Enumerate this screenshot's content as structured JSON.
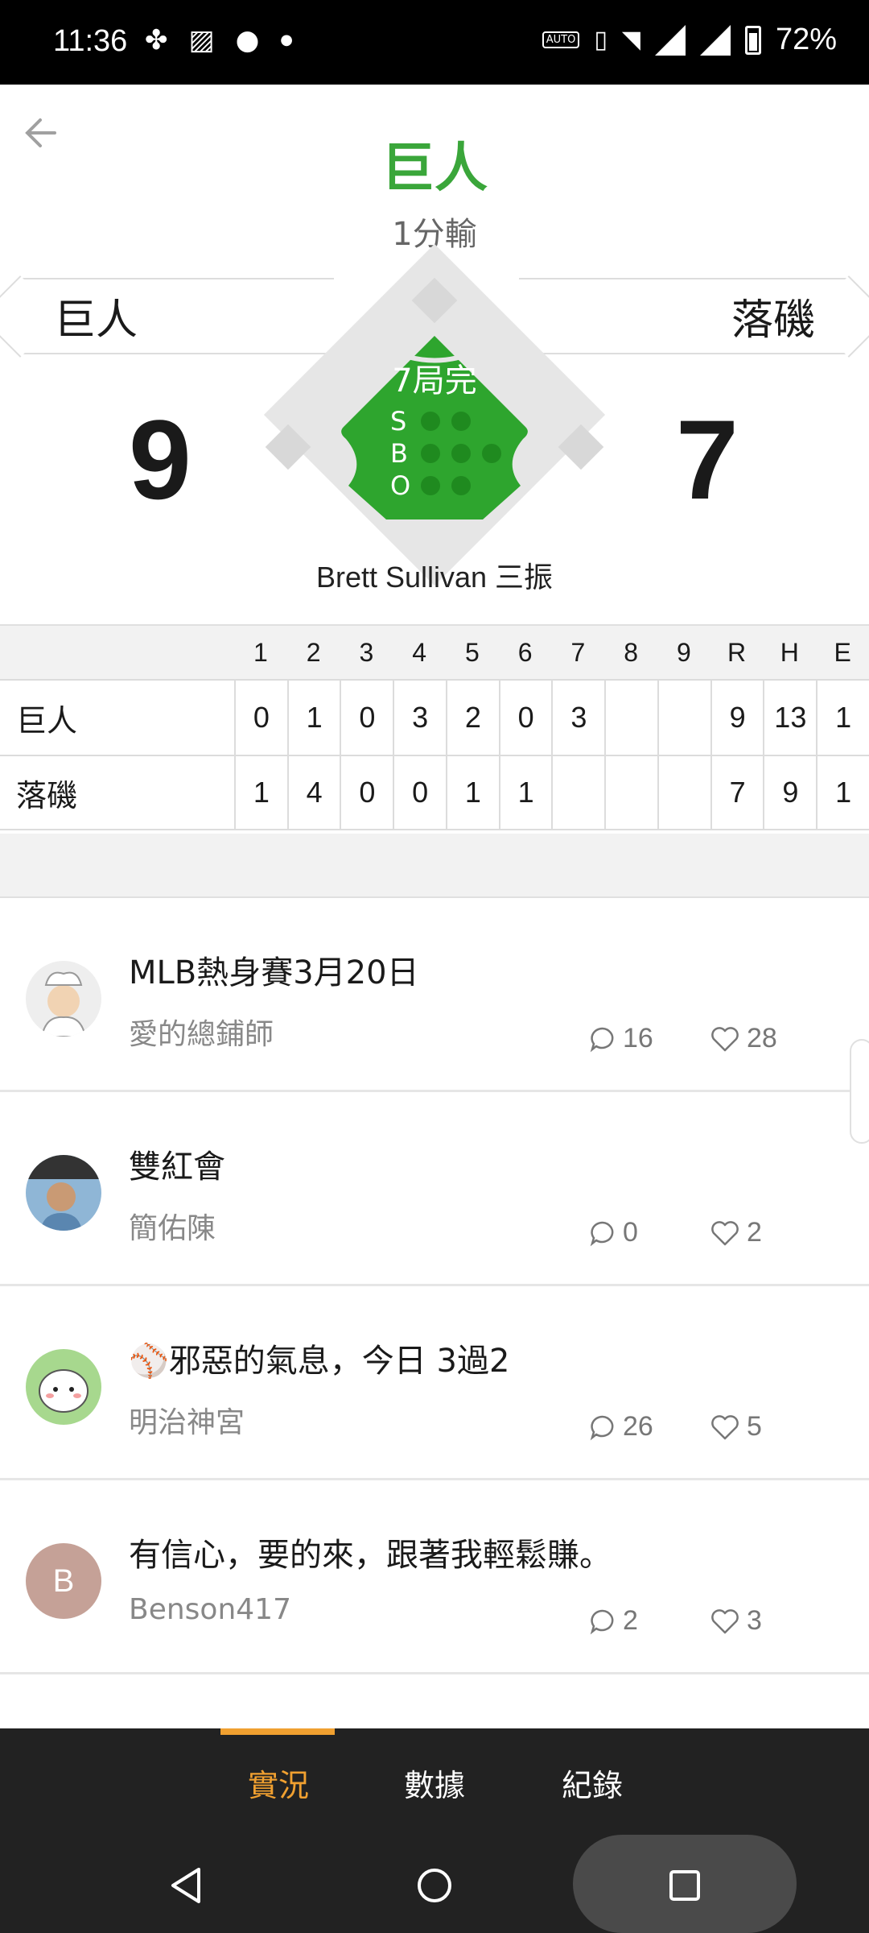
{
  "status_bar": {
    "time": "11:36",
    "battery": "72%"
  },
  "header": {
    "winner": "巨人",
    "result": "1分輸"
  },
  "scoreboard": {
    "away_team": "巨人",
    "home_team": "落磯",
    "away_score": "9",
    "home_score": "7",
    "inning": "7局完",
    "count_labels": [
      "S",
      "B",
      "O"
    ],
    "last_play": "Brett Sullivan 三振"
  },
  "linescore": {
    "columns": [
      "1",
      "2",
      "3",
      "4",
      "5",
      "6",
      "7",
      "8",
      "9",
      "R",
      "H",
      "E"
    ],
    "rows": [
      {
        "team": "巨人",
        "values": [
          "0",
          "1",
          "0",
          "3",
          "2",
          "0",
          "3",
          "",
          "",
          "9",
          "13",
          "1"
        ]
      },
      {
        "team": "落磯",
        "values": [
          "1",
          "4",
          "0",
          "0",
          "1",
          "1",
          "",
          "",
          "",
          "7",
          "9",
          "1"
        ]
      }
    ]
  },
  "posts": [
    {
      "title": "MLB熱身賽3月20日",
      "author": "愛的總鋪師",
      "comments": "16",
      "likes": "28"
    },
    {
      "title": "雙紅會",
      "author": "簡佑陳",
      "comments": "0",
      "likes": "2"
    },
    {
      "title": "⚾邪惡的氣息，今日 3過2",
      "author": "明治神宮",
      "comments": "26",
      "likes": "5"
    },
    {
      "title": "有信心，要的來，跟著我輕鬆賺。",
      "author": "Benson417",
      "comments": "2",
      "likes": "3",
      "avatar_letter": "B"
    }
  ],
  "bottom_tabs": [
    "實況",
    "數據",
    "紀錄"
  ],
  "colors": {
    "accent_green": "#3aa63a",
    "field_green": "#2ea52e",
    "active_tab": "#f0a030"
  }
}
